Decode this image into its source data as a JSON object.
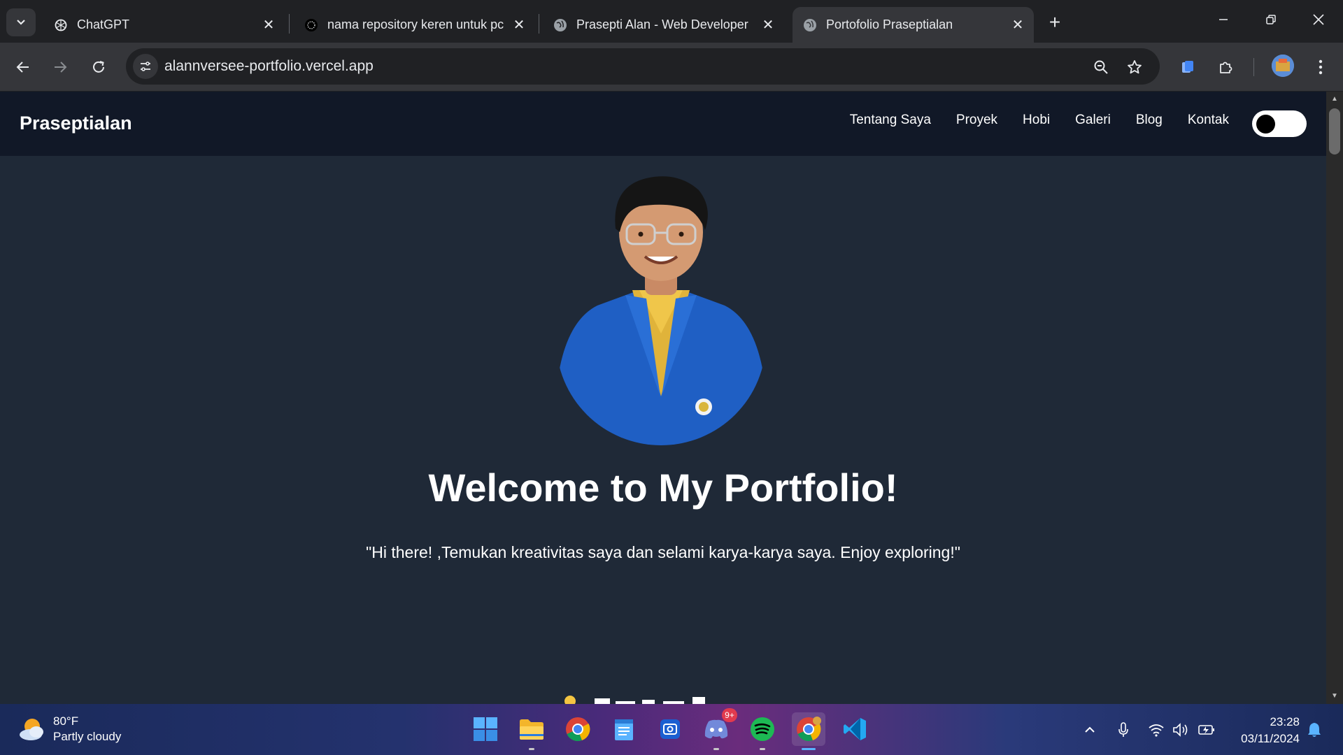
{
  "browser": {
    "tabs": [
      {
        "title": "ChatGPT",
        "icon": "chatgpt-icon",
        "active": false
      },
      {
        "title": "nama repository keren untuk pc",
        "icon": "perplexity-icon",
        "active": false
      },
      {
        "title": "Prasepti Alan - Web Developer",
        "icon": "globe-icon",
        "active": false
      },
      {
        "title": "Portofolio Praseptialan",
        "icon": "globe-icon",
        "active": true
      }
    ],
    "url": "alannversee-portfolio.vercel.app"
  },
  "site": {
    "brand": "Praseptialan",
    "nav": [
      "Tentang Saya",
      "Proyek",
      "Hobi",
      "Galeri",
      "Blog",
      "Kontak"
    ],
    "theme_toggle": "off",
    "hero": {
      "title": "Welcome to My Portfolio!",
      "subtitle": "\"Hi there! ,Temukan kreativitas saya dan selami karya-karya saya. Enjoy exploring!\""
    }
  },
  "taskbar": {
    "weather": {
      "temp": "80°F",
      "condition": "Partly cloudy"
    },
    "apps": [
      "windows-start",
      "file-explorer",
      "chrome",
      "notepad",
      "snipping-tool",
      "discord",
      "spotify",
      "chrome-profile",
      "vscode"
    ],
    "discord_badge": "9+",
    "clock": {
      "time": "23:28",
      "date": "03/11/2024"
    }
  },
  "colors": {
    "page_bg": "#1f2937",
    "nav_bg": "#111827",
    "chrome_dark": "#202124",
    "chrome_mid": "#35363a"
  }
}
